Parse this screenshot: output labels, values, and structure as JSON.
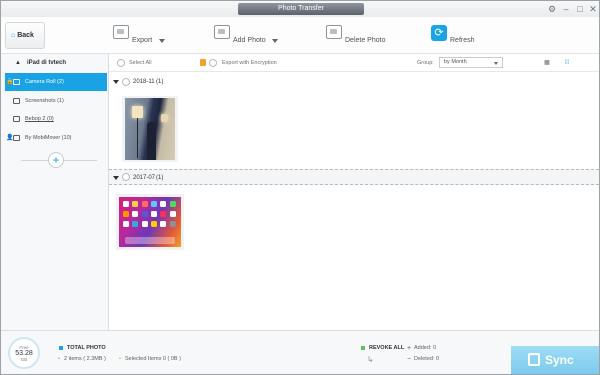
{
  "window": {
    "title": "Photo Transfer"
  },
  "toolbar": {
    "back_label": "Back",
    "export_label": "Export",
    "add_photo_label": "Add Photo",
    "delete_photo_label": "Delete Photo",
    "refresh_label": "Refresh"
  },
  "sidebar": {
    "device_name": "iPad di tvtech",
    "items": [
      {
        "label": "Camera Roll (2)",
        "active": true
      },
      {
        "label": "Screenshots (1)"
      },
      {
        "label": "Bebop 2 (0)"
      },
      {
        "label": "By MobiMover (10)"
      }
    ]
  },
  "main": {
    "select_all_label": "Select All",
    "export_encryption_label": "Export with Encryption",
    "group_label": "Group:",
    "group_value": "by Month",
    "groups": [
      {
        "date": "2018-11",
        "count": "(1)"
      },
      {
        "date": "2017-07",
        "count": "(1)"
      }
    ]
  },
  "footer": {
    "storage": {
      "label": "Free",
      "value": "53.28",
      "unit": "GB"
    },
    "total_photo_label": "TOTAL PHOTO",
    "items_text": "2 items ( 2.3MB )",
    "selected_text": "Selected Items 0 ( 0B )",
    "revoke_all_label": "REVOKE ALL",
    "added_text": "Added: 0",
    "deleted_text": "Deleted: 0",
    "sync_label": "Sync"
  },
  "colors": {
    "accent": "#1aa3e4",
    "sync": "#8fd5f2",
    "encryption_lock": "#f0a32a"
  }
}
